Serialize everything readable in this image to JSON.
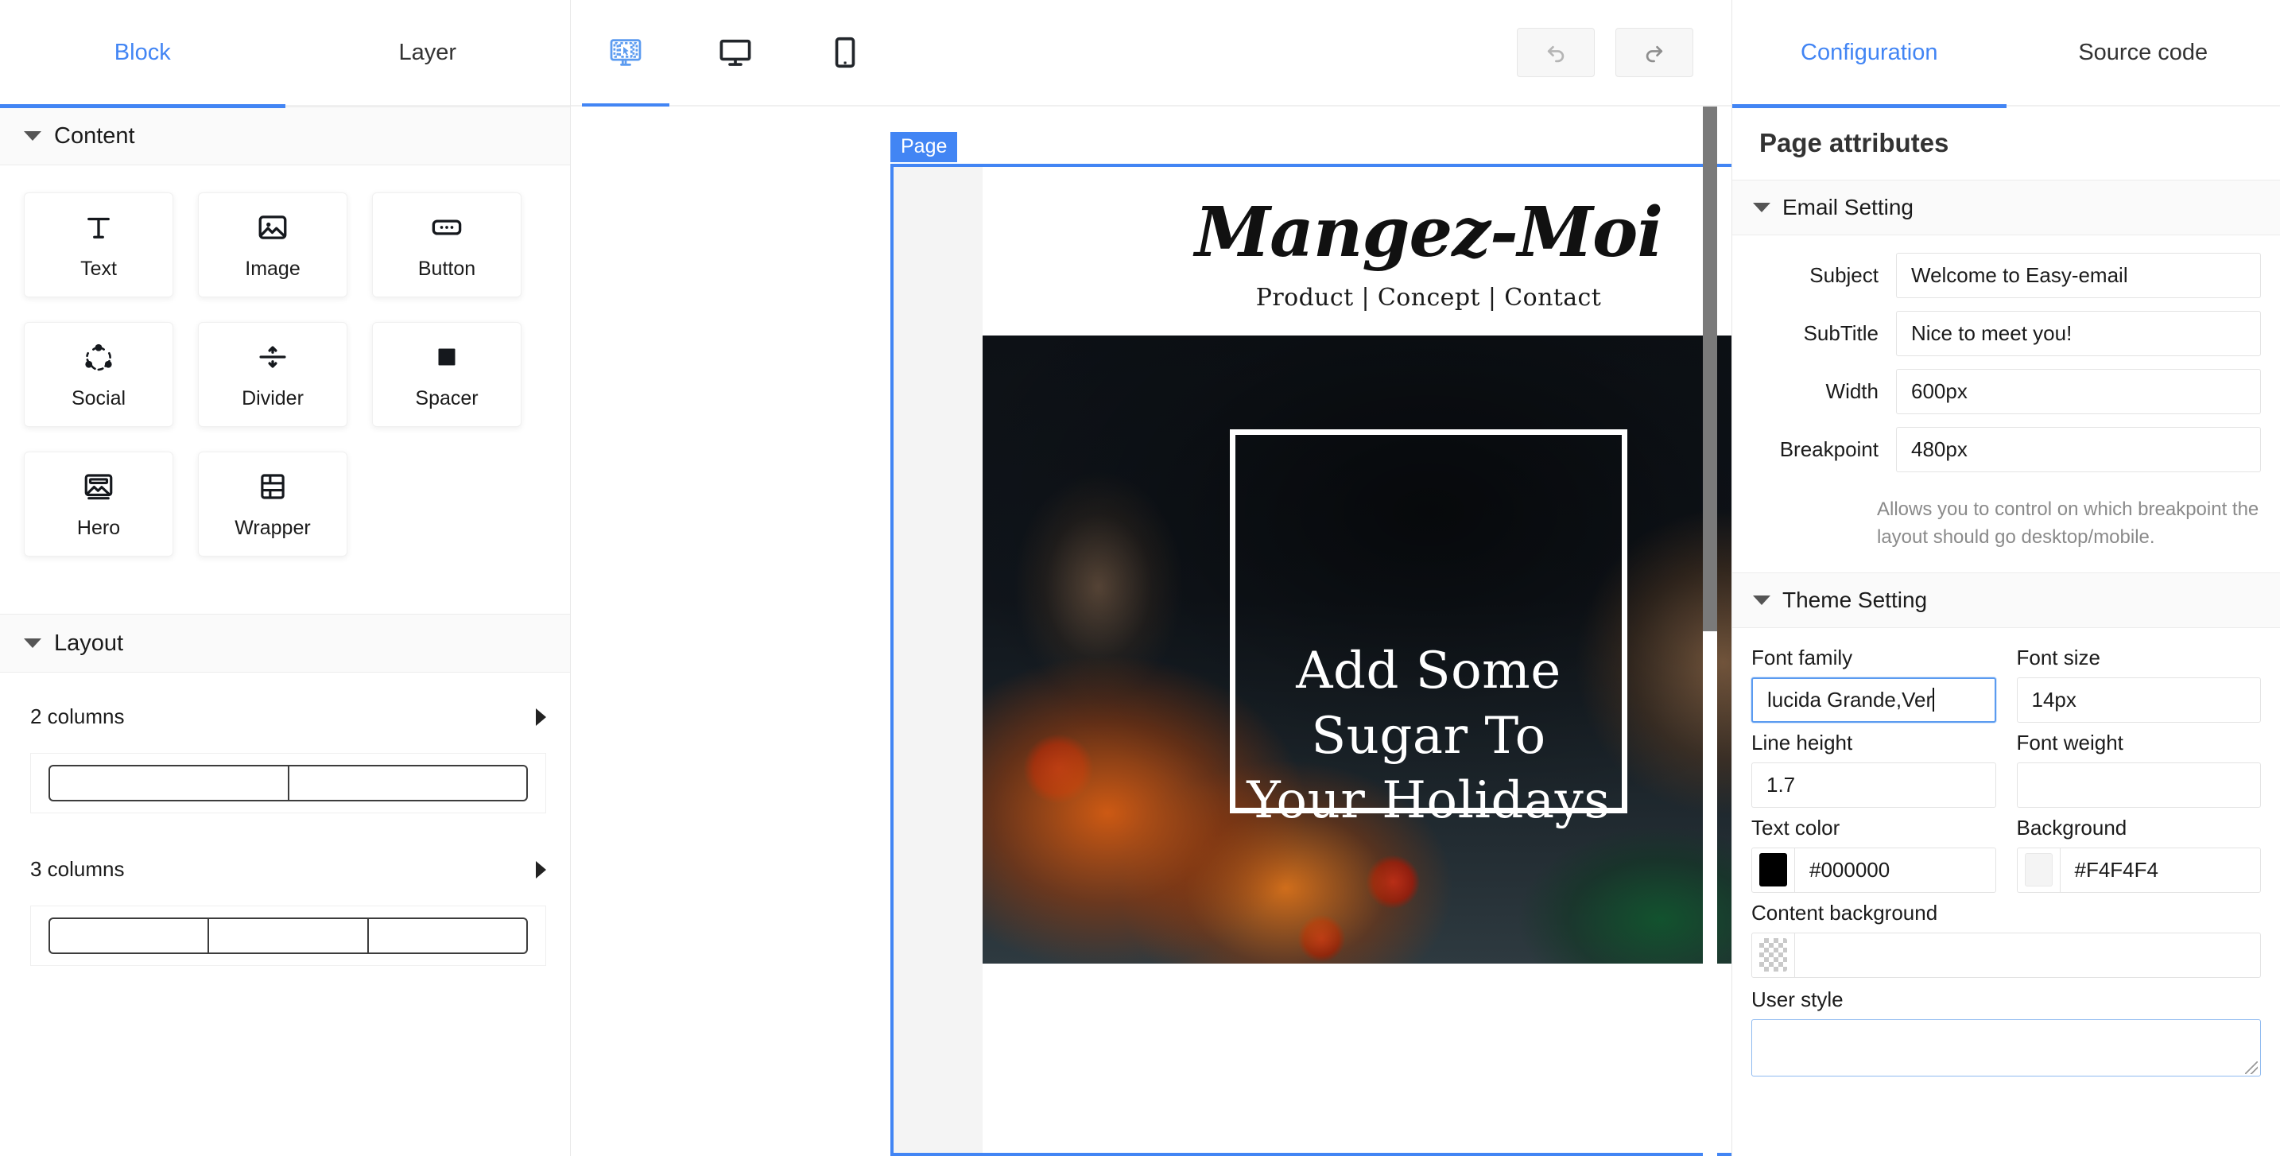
{
  "left_panel": {
    "tabs": [
      {
        "label": "Block",
        "active": true
      },
      {
        "label": "Layer",
        "active": false
      }
    ],
    "content_section": {
      "title": "Content"
    },
    "blocks": [
      {
        "label": "Text",
        "icon": "text-icon"
      },
      {
        "label": "Image",
        "icon": "image-icon"
      },
      {
        "label": "Button",
        "icon": "button-icon"
      },
      {
        "label": "Social",
        "icon": "social-icon"
      },
      {
        "label": "Divider",
        "icon": "divider-icon"
      },
      {
        "label": "Spacer",
        "icon": "spacer-icon"
      },
      {
        "label": "Hero",
        "icon": "hero-icon"
      },
      {
        "label": "Wrapper",
        "icon": "wrapper-icon"
      }
    ],
    "layout_section": {
      "title": "Layout"
    },
    "layouts": [
      {
        "label": "2 columns",
        "columns": 2
      },
      {
        "label": "3 columns",
        "columns": 3
      }
    ]
  },
  "center_panel": {
    "device_tabs": [
      {
        "icon": "edit-desktop-icon",
        "active": true
      },
      {
        "icon": "desktop-icon",
        "active": false
      },
      {
        "icon": "mobile-icon",
        "active": false
      }
    ],
    "history": [
      {
        "icon": "undo-icon",
        "label": "Undo"
      },
      {
        "icon": "redo-icon",
        "label": "Redo"
      }
    ],
    "selection_badge": "Page",
    "email": {
      "brand": "Mangez-Moi",
      "nav": "Product | Concept | Contact",
      "hero_lines": [
        "Add Some",
        "Sugar To",
        "Your Holidays"
      ]
    }
  },
  "right_panel": {
    "tabs": [
      {
        "label": "Configuration",
        "active": true
      },
      {
        "label": "Source code",
        "active": false
      }
    ],
    "title": "Page attributes",
    "email_setting": {
      "header": "Email Setting",
      "fields": [
        {
          "label": "Subject",
          "value": "Welcome to Easy-email"
        },
        {
          "label": "SubTitle",
          "value": "Nice to meet you!"
        },
        {
          "label": "Width",
          "value": "600px"
        },
        {
          "label": "Breakpoint",
          "value": "480px"
        }
      ],
      "helper": "Allows you to control on which breakpoint the layout should go desktop/mobile."
    },
    "theme_setting": {
      "header": "Theme Setting",
      "font_family": {
        "label": "Font family",
        "value": "lucida Grande,Ver",
        "focused": true
      },
      "font_size": {
        "label": "Font size",
        "value": "14px"
      },
      "line_height": {
        "label": "Line height",
        "value": "1.7"
      },
      "font_weight": {
        "label": "Font weight",
        "value": ""
      },
      "text_color": {
        "label": "Text color",
        "value": "#000000",
        "swatch": "#000000"
      },
      "background": {
        "label": "Background",
        "value": "#F4F4F4",
        "swatch": "#F4F4F4"
      },
      "content_background": {
        "label": "Content background",
        "value": "",
        "swatch": "transparent"
      },
      "user_style": {
        "label": "User style",
        "value": ""
      }
    }
  },
  "colors": {
    "accent": "#4285f4",
    "panel_bg": "#ffffff",
    "section_bg": "#fafafa",
    "canvas_bg": "#f4f4f4",
    "text": "#1b1b1b"
  }
}
